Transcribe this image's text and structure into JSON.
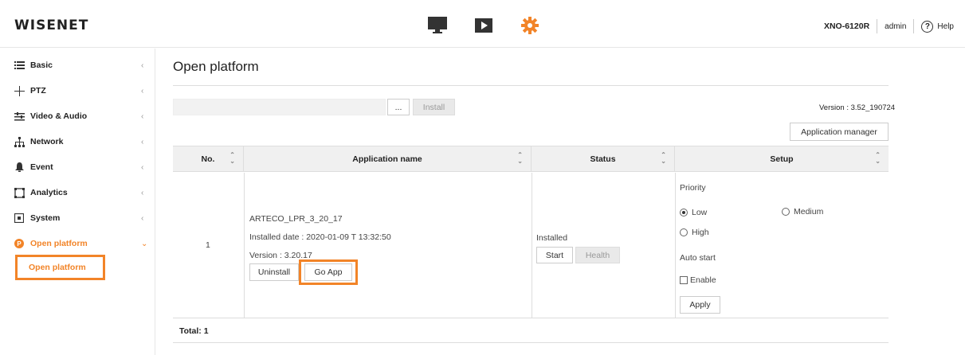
{
  "header": {
    "logo": "WISENET",
    "model": "XNO-6120R",
    "user": "admin",
    "help": "Help",
    "accent": "#f28428"
  },
  "top_icons": [
    "monitor-icon",
    "play-icon",
    "gear-icon"
  ],
  "sidebar": {
    "items": [
      {
        "label": "Basic",
        "icon": "list-icon"
      },
      {
        "label": "PTZ",
        "icon": "ptz-icon"
      },
      {
        "label": "Video & Audio",
        "icon": "sliders-icon"
      },
      {
        "label": "Network",
        "icon": "network-icon"
      },
      {
        "label": "Event",
        "icon": "bell-icon"
      },
      {
        "label": "Analytics",
        "icon": "analytics-icon"
      },
      {
        "label": "System",
        "icon": "system-icon"
      },
      {
        "label": "Open platform",
        "icon": "open-platform-icon"
      }
    ],
    "sub_item": "Open platform"
  },
  "main": {
    "title": "Open platform",
    "browse_label": "...",
    "install_label": "Install",
    "version": "Version : 3.52_190724",
    "app_manager_label": "Application manager"
  },
  "table": {
    "headers": [
      "No.",
      "Application name",
      "Status",
      "Setup"
    ],
    "row": {
      "no": "1",
      "app_name": "ARTECO_LPR_3_20_17",
      "installed_date": "Installed date : 2020-01-09 T 13:32:50",
      "version": "Version : 3.20.17",
      "uninstall_label": "Uninstall",
      "go_app_label": "Go App",
      "status": "Installed",
      "start_label": "Start",
      "health_label": "Health",
      "priority_label": "Priority",
      "priority_low": "Low",
      "priority_medium": "Medium",
      "priority_high": "High",
      "priority_selected": "Low",
      "auto_start_label": "Auto start",
      "enable_label": "Enable",
      "enable_checked": false,
      "apply_label": "Apply"
    },
    "total": "Total: 1"
  }
}
